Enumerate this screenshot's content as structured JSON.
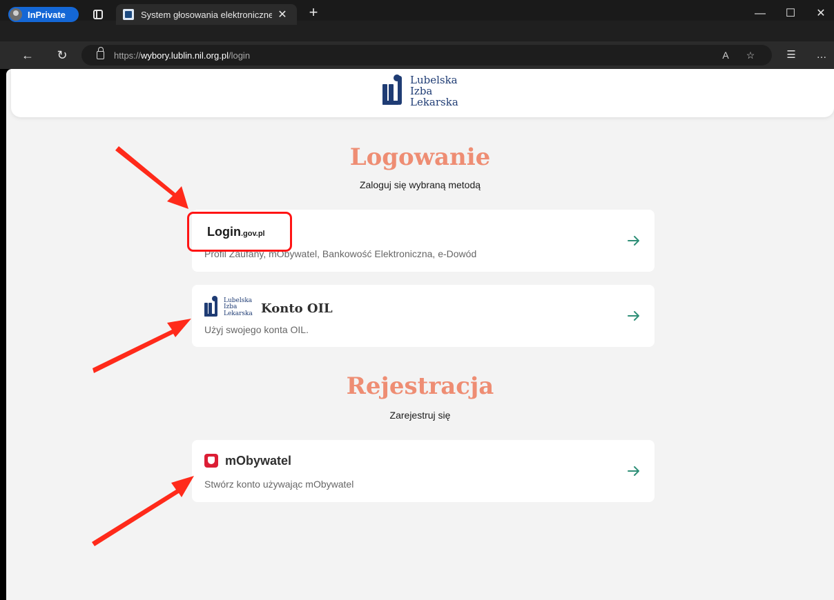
{
  "browser": {
    "inprivate_label": "InPrivate",
    "tab_title": "System głosowania elektronicznego",
    "tab_close": "✕",
    "new_tab": "+",
    "url_scheme": "https://",
    "url_domain": "wybory.lublin.nil.org.pl",
    "url_path": "/login",
    "minimize": "—",
    "maximize": "☐",
    "close": "✕"
  },
  "header": {
    "logo_lines": [
      "Lubelska",
      "Izba",
      "Lekarska"
    ]
  },
  "login": {
    "title": "Logowanie",
    "subtitle": "Zaloguj się wybraną metodą",
    "options": [
      {
        "logo_text_main": "Login",
        "logo_text_suffix": ".gov.pl",
        "description": "Profil Zaufany, mObywatel, Bankowość Elektroniczna, e-Dowód"
      },
      {
        "title": "Konto OIL",
        "description": "Użyj swojego konta OIL."
      }
    ]
  },
  "registration": {
    "title": "Rejestracja",
    "subtitle": "Zarejestruj się",
    "options": [
      {
        "title": "mObywatel",
        "description": "Stwórz konto używając mObywatel"
      }
    ]
  },
  "colors": {
    "accent_title": "#ee8d73",
    "arrow": "#2e8f77",
    "annotation": "#ff1414",
    "brand_navy": "#1f3c74"
  }
}
